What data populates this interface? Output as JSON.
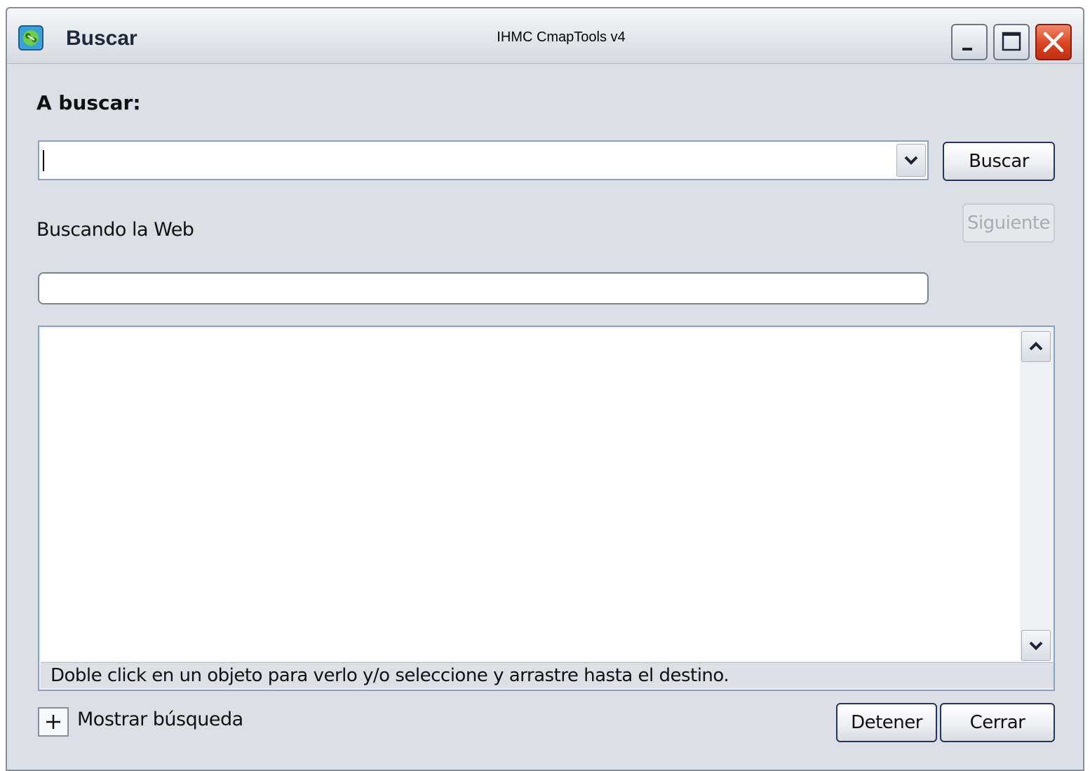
{
  "window": {
    "title": "Buscar",
    "app_title": "IHMC CmapTools v4",
    "app_icon": "cmaptools-icon",
    "controls": {
      "minimize": "minimize-icon",
      "maximize": "maximize-icon",
      "close": "close-icon"
    }
  },
  "search": {
    "label": "A buscar:",
    "query_value": "",
    "button_label": "Buscar",
    "next_label": "Siguiente",
    "next_enabled": false
  },
  "status": {
    "text": "Buscando la Web",
    "progress": 0
  },
  "results": {
    "items": [],
    "hint": "Doble click en un objeto para verlo y/o seleccione y arrastre hasta el destino."
  },
  "footer": {
    "toggle_symbol": "+",
    "show_label": "Mostrar búsqueda",
    "stop_label": "Detener",
    "close_label": "Cerrar"
  },
  "colors": {
    "window_bg": "#dcdfe5",
    "button_border": "#26365a",
    "close_button": "#d9431f",
    "field_border": "#8ba1bf",
    "disabled_text": "#a9acb2"
  }
}
